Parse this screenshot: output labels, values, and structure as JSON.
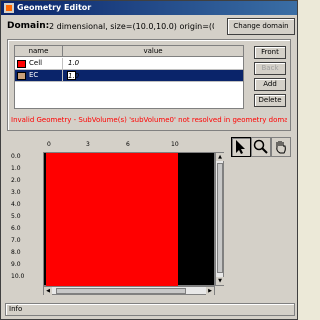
{
  "window": {
    "title": "Geometry Editor"
  },
  "domain": {
    "label": "Domain:",
    "text": "2 dimensional,  size=(10.0,10.0)  origin=(0.0,...",
    "change_button": "Change domain"
  },
  "table": {
    "headers": [
      "name",
      "value"
    ],
    "rows": [
      {
        "name": "Cell",
        "value": "1.0",
        "color": "#ff0000",
        "selected": false
      },
      {
        "name": "EC",
        "value": "1.0",
        "color": "#c8a07a",
        "selected": true
      }
    ]
  },
  "buttons": {
    "front": "Front",
    "back": "Back",
    "add": "Add",
    "delete": "Delete"
  },
  "error_message": "Invalid Geometry - SubVolume(s) 'subVolume0' not resolved in geometry domain",
  "tools": [
    "select-arrow-icon",
    "zoom-magnifier-icon",
    "pan-hand-icon"
  ],
  "viewer": {
    "x_ticks": [
      "0",
      "3",
      "6",
      "10"
    ],
    "y_ticks": [
      "0.0",
      "1.0",
      "2.0",
      "3.0",
      "4.0",
      "5.0",
      "6.0",
      "7.0",
      "8.0",
      "9.0",
      "10.0"
    ],
    "geometry_color": "#ff0000",
    "background_color": "#000000"
  },
  "status": {
    "text": "Info"
  }
}
